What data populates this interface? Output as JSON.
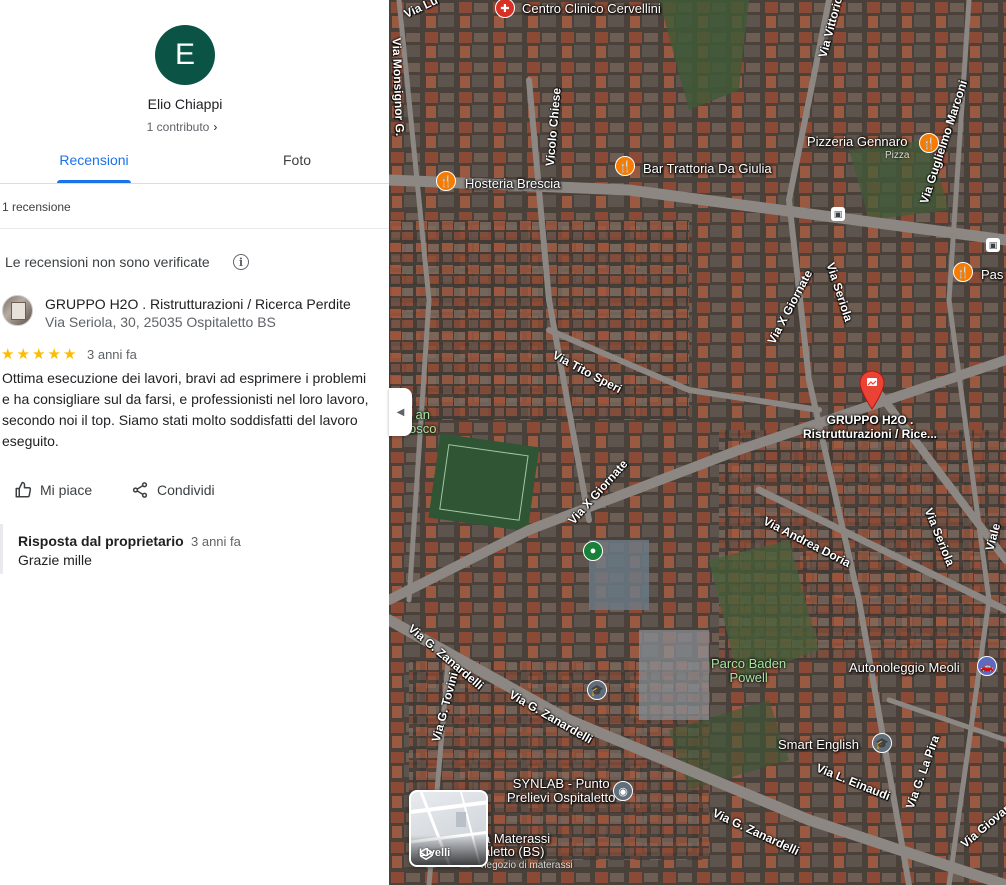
{
  "user": {
    "initial": "E",
    "name": "Elio Chiappi",
    "contributions": "1 contributo",
    "avatar_color": "#0b5345"
  },
  "tabs": [
    {
      "label": "Recensioni",
      "active": true
    },
    {
      "label": "Foto",
      "active": false
    }
  ],
  "review_count": "1 recensione",
  "unverified_notice": "Le recensioni non sono verificate",
  "review": {
    "place_name": "GRUPPO H2O . Ristrutturazioni / Ricerca Perdite",
    "place_address": "Via Seriola, 30, 25035 Ospitaletto BS",
    "rating": 5,
    "stars": "★★★★★",
    "age": "3 anni fa",
    "text": "Ottima esecuzione dei lavori, bravi ad esprimere i problemi e ha consigliare sul da farsi, e professionisti nel loro lavoro, secondo noi il top. Siamo stati molto soddisfatti del lavoro eseguito.",
    "like_label": "Mi piace",
    "share_label": "Condividi",
    "owner_reply": {
      "title": "Risposta dal proprietario",
      "age": "3 anni fa",
      "text": "Grazie mille"
    }
  },
  "map": {
    "streets": {
      "via_lu": "Via Lu",
      "via_monsignor": "Via Monsignor G.",
      "vicolo_chiese": "Vicolo Chiese",
      "via_vittorio": "Via Vittorio",
      "via_marconi": "Via Guglielmo Marconi",
      "via_x_giornate_top": "Via X Giornate",
      "via_seriola_top": "Via Seriola",
      "via_tito_speri": "Via Tito Speri",
      "via_x_giornate_mid": "Via X Giornate",
      "via_andrea_doria": "Via Andrea Doria",
      "via_seriola_bottom": "Via Seriola",
      "viale": "Viale",
      "via_zanardelli_left": "Via G. Zanardelli",
      "via_zanardelli_mid": "Via G. Zanardelli",
      "via_zanardelli_right": "Via G. Zanardelli",
      "via_tovini": "Via G. Tovini",
      "via_einaudi": "Via L. Einaudi",
      "via_la_pira": "Via G. La Pira",
      "via_giovanni": "Via Giovanni"
    },
    "pois": {
      "centro_clinico": "Centro Clinico Cervellini",
      "pizzeria": "Pizzeria Gennaro",
      "pizzeria_sub": "Pizza",
      "trattoria": "Bar Trattoria Da Giulia",
      "hosteria": "Hosteria Brescia",
      "pas": "Pas",
      "parco_line1": "Parco Baden",
      "parco_line2": "Powell",
      "autonoleggio": "Autonoleggio Meoli",
      "smart_english": "Smart English",
      "synlab_line1": "SYNLAB - Punto",
      "synlab_line2": "Prelievi Ospitaletto",
      "materassi_line1": "a Materassi",
      "materassi_line2": "aletto (BS)",
      "materassi_sub": "negozio di materassi",
      "san_line1": "an",
      "san_line2": "osco",
      "selected_line1": "GRUPPO H2O .",
      "selected_line2": "Ristrutturazioni / Rice..."
    },
    "layers_label": "Livelli",
    "accent_color": "#1a73e8",
    "pin_color": "#ea4335"
  }
}
